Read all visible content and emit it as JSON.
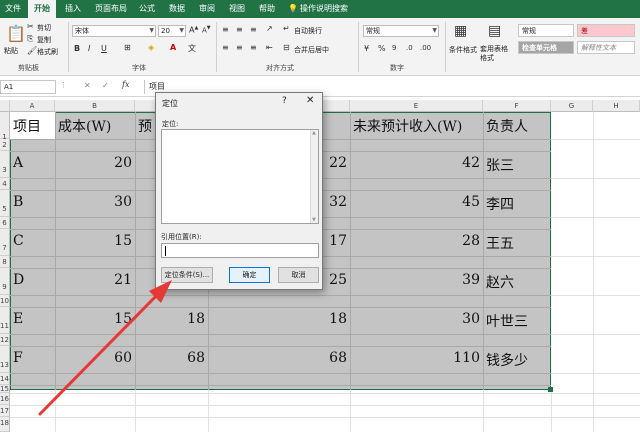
{
  "tabs": [
    "文件",
    "开始",
    "插入",
    "页面布局",
    "公式",
    "数据",
    "审阅",
    "视图",
    "帮助"
  ],
  "active_tab": 1,
  "tell_me": "操作说明搜索",
  "ribbon": {
    "clipboard": {
      "paste": "粘贴",
      "cut": "剪切",
      "copy": "复制",
      "format_painter": "格式刷",
      "label": "剪贴板"
    },
    "font": {
      "name": "宋体",
      "size": "20",
      "label": "字体"
    },
    "alignment": {
      "wrap": "自动换行",
      "merge": "合并后居中",
      "label": "对齐方式"
    },
    "number": {
      "format": "常规",
      "label": "数字"
    },
    "styles": {
      "conditional": "条件格式",
      "table": "套用表格格式",
      "normal": "常规",
      "bad": "差",
      "check_cell": "检查单元格",
      "explanatory": "解释性文本"
    }
  },
  "namebox": "A1",
  "formula_value": "项目",
  "columns": [
    "A",
    "B",
    "C",
    "D",
    "E",
    "F",
    "G",
    "H"
  ],
  "rows": [
    "1",
    "2",
    "3",
    "4",
    "5",
    "6",
    "7",
    "8",
    "9",
    "10",
    "11",
    "12",
    "13",
    "14",
    "15",
    "16",
    "17",
    "18"
  ],
  "headers": [
    "项目",
    "成本(W)",
    "预",
    "",
    "未来预计收入(W)",
    "负责人"
  ],
  "table": [
    {
      "item": "A",
      "cost": "20",
      "c": "",
      "d": "22",
      "income": "42",
      "owner": "张三"
    },
    {
      "item": "B",
      "cost": "30",
      "c": "",
      "d": "32",
      "income": "45",
      "owner": "李四"
    },
    {
      "item": "C",
      "cost": "15",
      "c": "",
      "d": "17",
      "income": "28",
      "owner": "王五"
    },
    {
      "item": "D",
      "cost": "21",
      "c": "",
      "d": "25",
      "income": "39",
      "owner": "赵六"
    },
    {
      "item": "E",
      "cost": "15",
      "c": "18",
      "d": "18",
      "income": "30",
      "owner": "叶世三"
    },
    {
      "item": "F",
      "cost": "60",
      "c": "68",
      "d": "68",
      "income": "110",
      "owner": "钱多少"
    }
  ],
  "dialog": {
    "title": "定位",
    "help": "?",
    "close": "✕",
    "goto_label": "定位:",
    "ref_label": "引用位置(R):",
    "special_button": "定位条件(S)...",
    "ok_button": "确定",
    "cancel_button": "取消"
  },
  "colors": {
    "excel_green": "#217346",
    "arrow_red": "#e53935",
    "selection": "#c4c4c4"
  }
}
